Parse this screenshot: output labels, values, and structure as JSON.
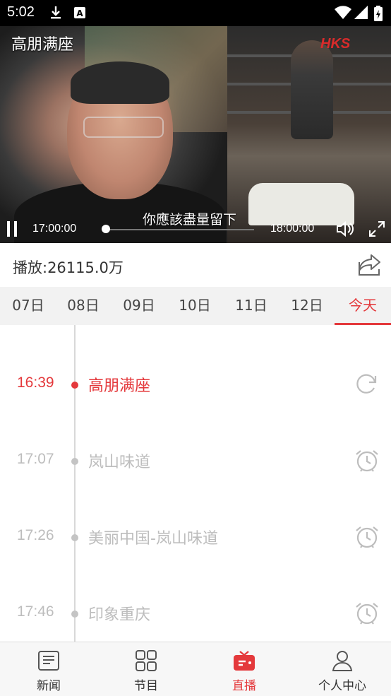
{
  "status_bar": {
    "time": "5:02"
  },
  "player": {
    "title": "高朋满座",
    "logo": "HKS",
    "subtitle": "你應該盡量留下",
    "time_start": "17:00:00",
    "time_end": "18:00:00",
    "progress": 0.0
  },
  "info": {
    "play_count": "播放:26115.0万"
  },
  "days": [
    {
      "label": "07日",
      "active": false
    },
    {
      "label": "08日",
      "active": false
    },
    {
      "label": "09日",
      "active": false
    },
    {
      "label": "10日",
      "active": false
    },
    {
      "label": "11日",
      "active": false
    },
    {
      "label": "12日",
      "active": false
    },
    {
      "label": "今天",
      "active": true
    }
  ],
  "schedule": [
    {
      "time": "16:39",
      "name": "高朋满座",
      "current": true,
      "icon": "replay-icon"
    },
    {
      "time": "17:07",
      "name": "岚山味道",
      "current": false,
      "icon": "alarm-clock-icon"
    },
    {
      "time": "17:26",
      "name": "美丽中国-岚山味道",
      "current": false,
      "icon": "alarm-clock-icon"
    },
    {
      "time": "17:46",
      "name": "印象重庆",
      "current": false,
      "icon": "alarm-clock-icon"
    }
  ],
  "tabs": [
    {
      "label": "新闻",
      "icon": "news-icon",
      "active": false
    },
    {
      "label": "节目",
      "icon": "grid-icon",
      "active": false
    },
    {
      "label": "直播",
      "icon": "tv-icon",
      "active": true
    },
    {
      "label": "个人中心",
      "icon": "user-icon",
      "active": false
    }
  ],
  "colors": {
    "accent": "#e4393c",
    "inactive": "#bdbdbd"
  }
}
